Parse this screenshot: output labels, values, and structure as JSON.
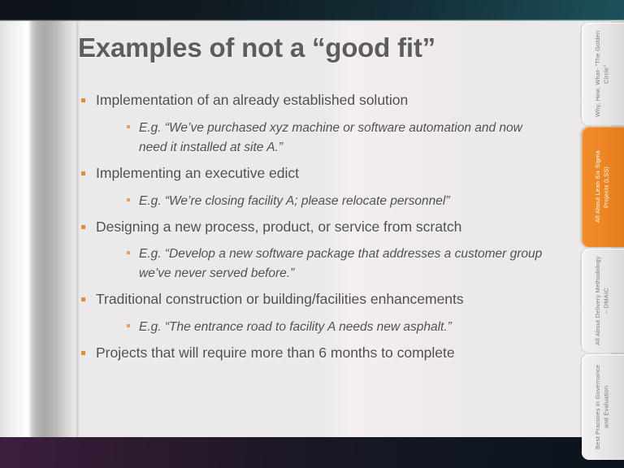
{
  "slide": {
    "title": "Examples of not a “good fit”",
    "background_color": "#ebe9e9",
    "title_color": "#5d5c60",
    "accent_color": "#e08a3c",
    "top_bar_color": "#143039",
    "bottom_bar_color": "#3c1f3d"
  },
  "bullets": [
    {
      "level": 1,
      "text": "Implementation of an already established solution"
    },
    {
      "level": 2,
      "text": "E.g. “We’ve purchased xyz machine or software automation and now need it installed at site A.”"
    },
    {
      "level": 1,
      "text": "Implementing an executive edict"
    },
    {
      "level": 2,
      "text": "E.g. “We’re closing facility A; please relocate personnel”"
    },
    {
      "level": 1,
      "text": "Designing a new process, product, or service from scratch"
    },
    {
      "level": 2,
      "text": "E.g. “Develop a new software package that addresses a customer group we’ve never served before.”"
    },
    {
      "level": 1,
      "text": "Traditional construction or building/facilities enhancements"
    },
    {
      "level": 2,
      "text": "E.g. “The entrance road to facility A needs new asphalt.”"
    },
    {
      "level": 1,
      "text": "Projects that will require more than 6 months to complete"
    }
  ],
  "side_tabs": [
    {
      "label": "Why, How, What- “The Golden Circle”",
      "active": false
    },
    {
      "label": "All About Lean Six Sigma Projects (LSS)",
      "active": true
    },
    {
      "label": "All About Delivery Methodology – DMAIC",
      "active": false
    },
    {
      "label": "Best Practices in Governance and Evaluation",
      "active": false
    }
  ]
}
